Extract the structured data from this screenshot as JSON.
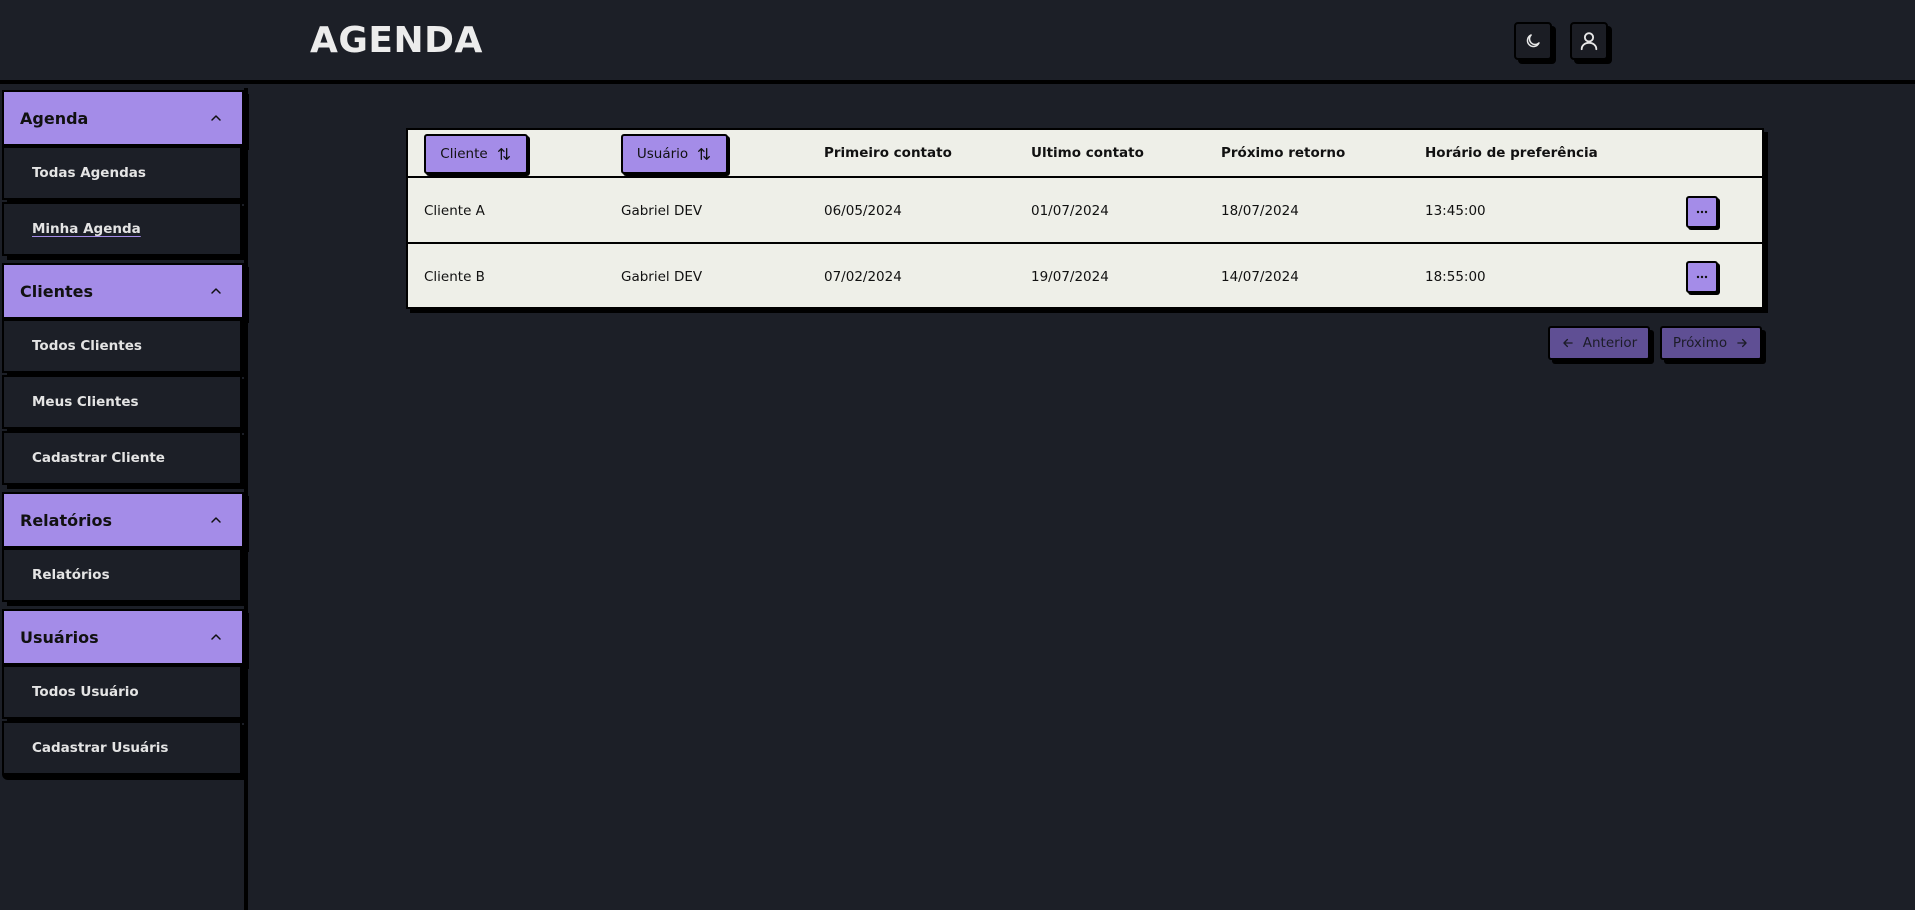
{
  "header": {
    "title": "AGENDA",
    "theme_toggle_icon": "moon-icon",
    "profile_icon": "user-icon"
  },
  "sidebar": {
    "sections": [
      {
        "title": "Agenda",
        "items": [
          "Todas Agendas",
          "Minha Agenda"
        ]
      },
      {
        "title": "Clientes",
        "items": [
          "Todos Clientes",
          "Meus Clientes",
          "Cadastrar Cliente"
        ]
      },
      {
        "title": "Relatórios",
        "items": [
          "Relatórios"
        ]
      },
      {
        "title": "Usuários",
        "items": [
          "Todos Usuário",
          "Cadastrar Usuáris"
        ]
      }
    ],
    "active_item": "Minha Agenda"
  },
  "table": {
    "columns": {
      "cliente": "Cliente",
      "usuario": "Usuário",
      "primeiro_contato": "Primeiro contato",
      "ultimo_contato": "Ultimo contato",
      "proximo_retorno": "Próximo retorno",
      "horario": "Horário de preferência"
    },
    "rows": [
      {
        "cliente": "Cliente A",
        "usuario": "Gabriel DEV",
        "primeiro_contato": "06/05/2024",
        "ultimo_contato": "01/07/2024",
        "proximo_retorno": "18/07/2024",
        "horario": "13:45:00"
      },
      {
        "cliente": "Cliente B",
        "usuario": "Gabriel DEV",
        "primeiro_contato": "07/02/2024",
        "ultimo_contato": "19/07/2024",
        "proximo_retorno": "14/07/2024",
        "horario": "18:55:00"
      }
    ]
  },
  "pagination": {
    "previous_label": "Anterior",
    "next_label": "Próximo"
  },
  "colors": {
    "accent": "#a48ce8",
    "accent_dark": "#5f4f94",
    "background": "#1c1f27",
    "table_bg": "#eeefe8"
  }
}
